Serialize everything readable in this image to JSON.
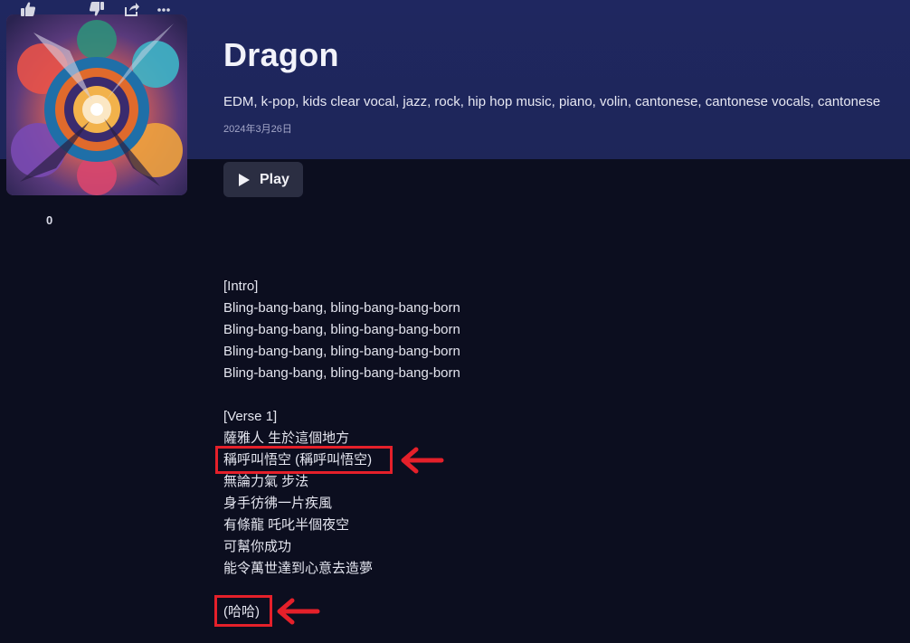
{
  "song": {
    "title": "Dragon",
    "tags": "EDM, k-pop, kids clear vocal, jazz, rock, hip hop music, piano, volin, cantonese, cantonese vocals, cantonese",
    "date": "2024年3月26日",
    "play_label": "Play"
  },
  "actions": {
    "like_count": "0",
    "like_icon": "thumbs-up-icon",
    "dislike_icon": "thumbs-down-icon",
    "share_icon": "share-icon",
    "more_icon": "more-icon"
  },
  "lyrics": {
    "intro_header": "[Intro]",
    "intro_lines": [
      "Bling-bang-bang, bling-bang-bang-born",
      "Bling-bang-bang, bling-bang-bang-born",
      "Bling-bang-bang, bling-bang-bang-born",
      "Bling-bang-bang, bling-bang-bang-born"
    ],
    "verse_header": "[Verse 1]",
    "verse_lines": [
      "薩雅人 生於這個地方",
      "稱呼叫悟空 (稱呼叫悟空)",
      "無論力氣 步法",
      "身手彷彿一片疾風",
      "有條龍 吒叱半個夜空",
      "可幫你成功",
      "能令萬世達到心意去造夢"
    ],
    "outro_line": "(哈哈)"
  },
  "colors": {
    "header_bg": "#1f2760",
    "page_bg": "#0c0e1f",
    "annotation_red": "#e5202a"
  }
}
